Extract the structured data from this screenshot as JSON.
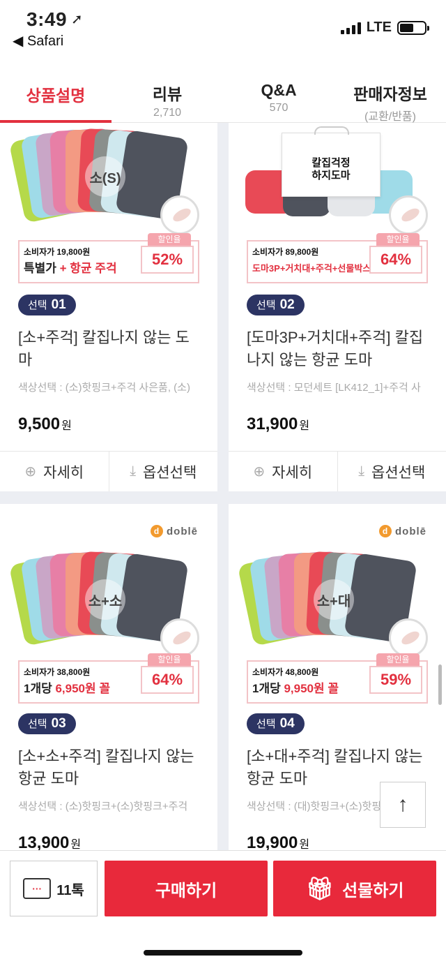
{
  "status": {
    "time": "3:49",
    "back_label": "◀ Safari",
    "network": "LTE"
  },
  "tabs": [
    {
      "label": "상품설명",
      "sub": ""
    },
    {
      "label": "리뷰",
      "sub": "2,710"
    },
    {
      "label": "Q&A",
      "sub": "570"
    },
    {
      "label": "판매자정보",
      "sub": "(교환/반품)"
    }
  ],
  "products": [
    {
      "image_label": "소(S)",
      "brand": "",
      "consumer_price": "소비자가 19,800원",
      "special_a": "특별가",
      "special_b": " + 항균 주걱",
      "discount_label": "할인율",
      "discount": "52%",
      "select_label": "선택",
      "select_no": "01",
      "name": "[소+주걱] 칼집나지 않는 도마",
      "option": "색상선택 : (소)핫핑크+주걱 사은품, (소)",
      "price": "9,500",
      "won": "원",
      "detail_label": "자세히",
      "option_label": "옵션선택"
    },
    {
      "image_label": "칼집걱정\n하지도마",
      "brand": "",
      "consumer_price": "소비자가 89,800원",
      "special_a": "도마3P+거치대+주걱+선물박스",
      "special_b": "",
      "discount_label": "할인율",
      "discount": "64%",
      "select_label": "선택",
      "select_no": "02",
      "name": "[도마3P+거치대+주걱] 칼집나지 않는 항균 도마",
      "option": "색상선택 : 모던세트 [LK412_1]+주걱 사",
      "price": "31,900",
      "won": "원",
      "detail_label": "자세히",
      "option_label": "옵션선택"
    },
    {
      "image_label": "소+소",
      "brand": "doblē",
      "consumer_price": "소비자가 38,800원",
      "special_a": "1개당 ",
      "special_b": "6,950원 꼴",
      "discount_label": "할인율",
      "discount": "64%",
      "select_label": "선택",
      "select_no": "03",
      "name": "[소+소+주걱] 칼집나지 않는 항균 도마",
      "option": "색상선택 : (소)핫핑크+(소)핫핑크+주걱",
      "price": "13,900",
      "won": "원"
    },
    {
      "image_label": "소+대",
      "brand": "doblē",
      "consumer_price": "소비자가 48,800원",
      "special_a": "1개당 ",
      "special_b": "9,950원 꼴",
      "discount_label": "할인율",
      "discount": "59%",
      "select_label": "선택",
      "select_no": "04",
      "name": "[소+대+주걱] 칼집나지 않는 항균 도마",
      "option": "색상선택 : (대)핫핑크+(소)핫핑크+주걱",
      "price": "19,900",
      "won": "원"
    }
  ],
  "bottom": {
    "talk_count": "11톡",
    "buy_label": "구매하기",
    "gift_label": "선물하기"
  },
  "colors": {
    "accent": "#e2303f",
    "badge": "#2c3463"
  },
  "icons": {
    "detail": "zoom-icon",
    "option": "download-icon",
    "top": "arrow-up-icon",
    "talk": "chat-bubble-icon",
    "gift": "gift-icon"
  }
}
